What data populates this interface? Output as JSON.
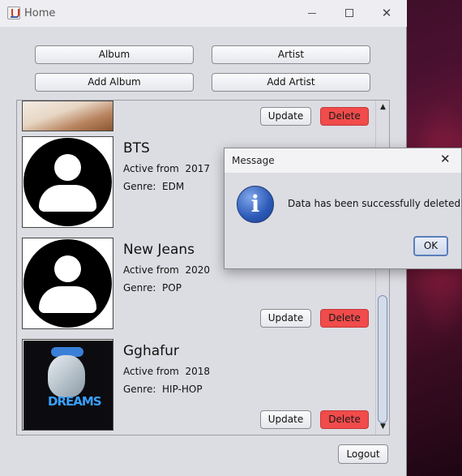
{
  "window": {
    "title": "Home"
  },
  "toolbar": {
    "album_label": "Album",
    "artist_label": "Artist",
    "add_album_label": "Add Album",
    "add_artist_label": "Add Artist"
  },
  "artists": [
    {
      "name": "BTS",
      "active_label": "Active from",
      "active_year": "2017",
      "genre_label": "Genre:",
      "genre": "EDM"
    },
    {
      "name": "New Jeans",
      "active_label": "Active from",
      "active_year": "2020",
      "genre_label": "Genre:",
      "genre": "POP"
    },
    {
      "name": "Gghafur",
      "active_label": "Active from",
      "active_year": "2018",
      "genre_label": "Genre:",
      "genre": "HIP-HOP"
    }
  ],
  "card_actions": {
    "update_label": "Update",
    "delete_label": "Delete"
  },
  "album_art": {
    "text": "DREAMS"
  },
  "footer": {
    "logout_label": "Logout"
  },
  "dialog": {
    "title": "Message",
    "message": "Data has been successfully deleted!",
    "ok_label": "OK"
  },
  "colors": {
    "delete_button": "#f14b4b",
    "window_bg": "#dcdde3",
    "info_icon": "#2b59b8"
  },
  "icons": {
    "app": "java-cup-icon",
    "minimize": "minimize-icon",
    "maximize": "maximize-icon",
    "close": "close-icon",
    "info": "info-icon",
    "avatar": "person-icon"
  }
}
